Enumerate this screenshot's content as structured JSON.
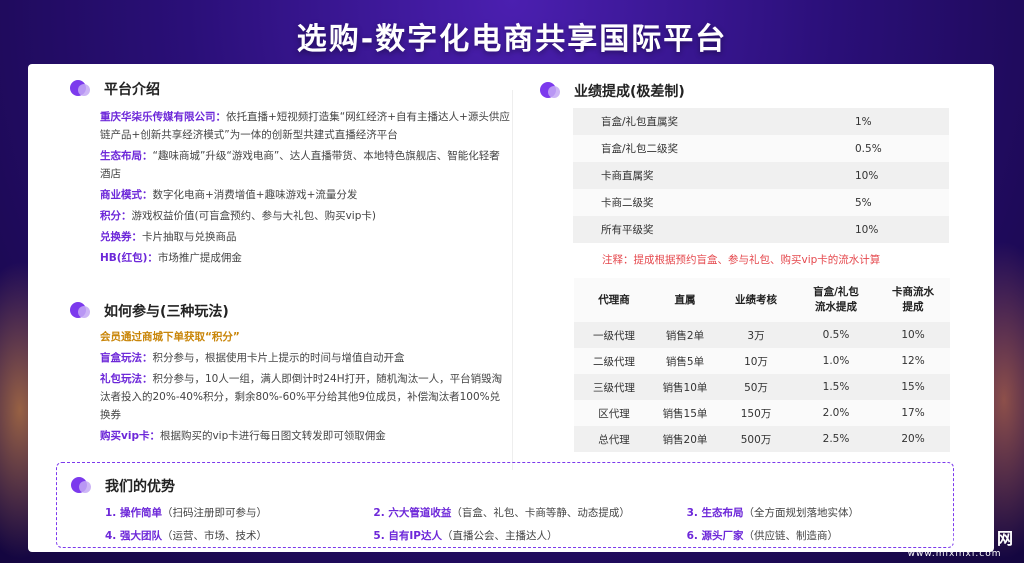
{
  "page_title": "选购-数字化电商共享国际平台",
  "platform_intro": {
    "title": "平台介绍",
    "items": [
      {
        "label": "重庆华柒乐传媒有限公司：",
        "text": "依托直播+短视频打造集“网红经济+自有主播达人+源头供应链产品+创新共享经济模式”为一体的创新型共建式直播经济平台"
      },
      {
        "label": "生态布局：",
        "text": "“趣味商城”升级“游戏电商”、达人直播带货、本地特色旗舰店、智能化轻奢酒店"
      },
      {
        "label": "商业模式：",
        "text": "数字化电商+消费增值+趣味游戏+流量分发"
      },
      {
        "label": "积分：",
        "text": "游戏权益价值(可盲盒预约、参与大礼包、购买vip卡)"
      },
      {
        "label": "兑换券：",
        "text": "卡片抽取与兑换商品"
      },
      {
        "label": "HB(红包)：",
        "text": "市场推广提成佣金"
      }
    ]
  },
  "how_to_join": {
    "title": "如何参与(三种玩法)",
    "highlight": "会员通过商城下单获取“积分”",
    "items": [
      {
        "label": "盲盒玩法：",
        "text": "积分参与，根据使用卡片上提示的时间与增值自动开盒"
      },
      {
        "label": "礼包玩法：",
        "text": "积分参与，10人一组，满人即倒计时24H打开，随机淘汰一人，平台销毁淘汰者投入的20%-40%积分，剩余80%-60%平分给其他9位成员，补偿淘汰者100%兑换券"
      },
      {
        "label": "购买vip卡：",
        "text": "根据购买的vip卡进行每日图文转发即可领取佣金"
      }
    ]
  },
  "commission": {
    "title": "业绩提成(极差制)",
    "rows": [
      {
        "name": "盲盒/礼包直属奖",
        "value": "1%"
      },
      {
        "name": "盲盒/礼包二级奖",
        "value": "0.5%"
      },
      {
        "name": "卡商直属奖",
        "value": "10%"
      },
      {
        "name": "卡商二级奖",
        "value": "5%"
      },
      {
        "name": "所有平级奖",
        "value": "10%"
      }
    ],
    "note": "注释：提成根据预约盲盒、参与礼包、购买vip卡的流水计算"
  },
  "agent_table": {
    "headers": [
      "代理商",
      "直属",
      "业绩考核",
      "盲盒/礼包\n流水提成",
      "卡商流水\n提成"
    ],
    "rows": [
      [
        "一级代理",
        "销售2单",
        "3万",
        "0.5%",
        "10%"
      ],
      [
        "二级代理",
        "销售5单",
        "10万",
        "1.0%",
        "12%"
      ],
      [
        "三级代理",
        "销售10单",
        "50万",
        "1.5%",
        "15%"
      ],
      [
        "区代理",
        "销售15单",
        "150万",
        "2.0%",
        "17%"
      ],
      [
        "总代理",
        "销售20单",
        "500万",
        "2.5%",
        "20%"
      ]
    ]
  },
  "advantages": {
    "title": "我们的优势",
    "items": [
      {
        "num": "1. 操作简单",
        "desc": "（扫码注册即可参与）"
      },
      {
        "num": "2. 六大管道收益",
        "desc": "（盲盒、礼包、卡商等静、动态提成）"
      },
      {
        "num": "3. 生态布局",
        "desc": "（全方面规划落地实体）"
      },
      {
        "num": "4. 强大团队",
        "desc": "（运营、市场、技术）"
      },
      {
        "num": "5. 自有IP达人",
        "desc": "（直播公会、主播达人）"
      },
      {
        "num": "6. 源头厂家",
        "desc": "（供应链、制造商）"
      }
    ]
  },
  "watermark": {
    "main": "MI信息首码网",
    "sub": "www.mixinxi.com"
  }
}
